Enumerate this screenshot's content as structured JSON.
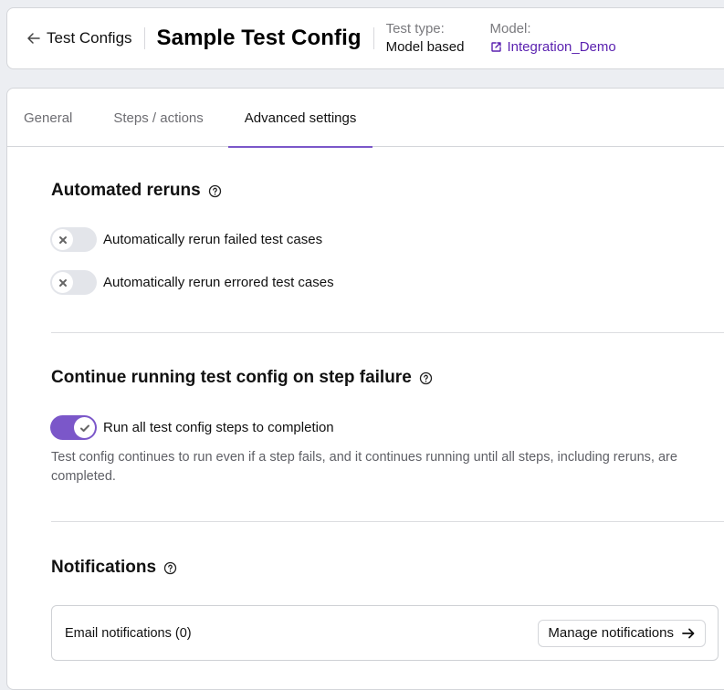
{
  "header": {
    "back_label": "Test Configs",
    "title": "Sample Test Config",
    "test_type_label": "Test type:",
    "test_type_value": "Model based",
    "model_label": "Model:",
    "model_value": "Integration_Demo"
  },
  "tabs": [
    {
      "label": "General",
      "active": false
    },
    {
      "label": "Steps / actions",
      "active": false
    },
    {
      "label": "Advanced settings",
      "active": true
    }
  ],
  "sections": {
    "automated_reruns": {
      "title": "Automated reruns",
      "toggles": [
        {
          "label": "Automatically rerun failed test cases",
          "on": false
        },
        {
          "label": "Automatically rerun errored test cases",
          "on": false
        }
      ]
    },
    "continue_running": {
      "title": "Continue running test config on step failure",
      "toggle": {
        "label": "Run all test config steps to completion",
        "on": true
      },
      "description": "Test config continues to run even if a step fails, and it continues running until all steps, including reruns, are completed."
    },
    "notifications": {
      "title": "Notifications",
      "email_label": "Email notifications (0)",
      "manage_button": "Manage notifications"
    }
  },
  "colors": {
    "accent": "#7b57c9",
    "link": "#5b22b0",
    "toggle_off": "#e3e5ea"
  }
}
